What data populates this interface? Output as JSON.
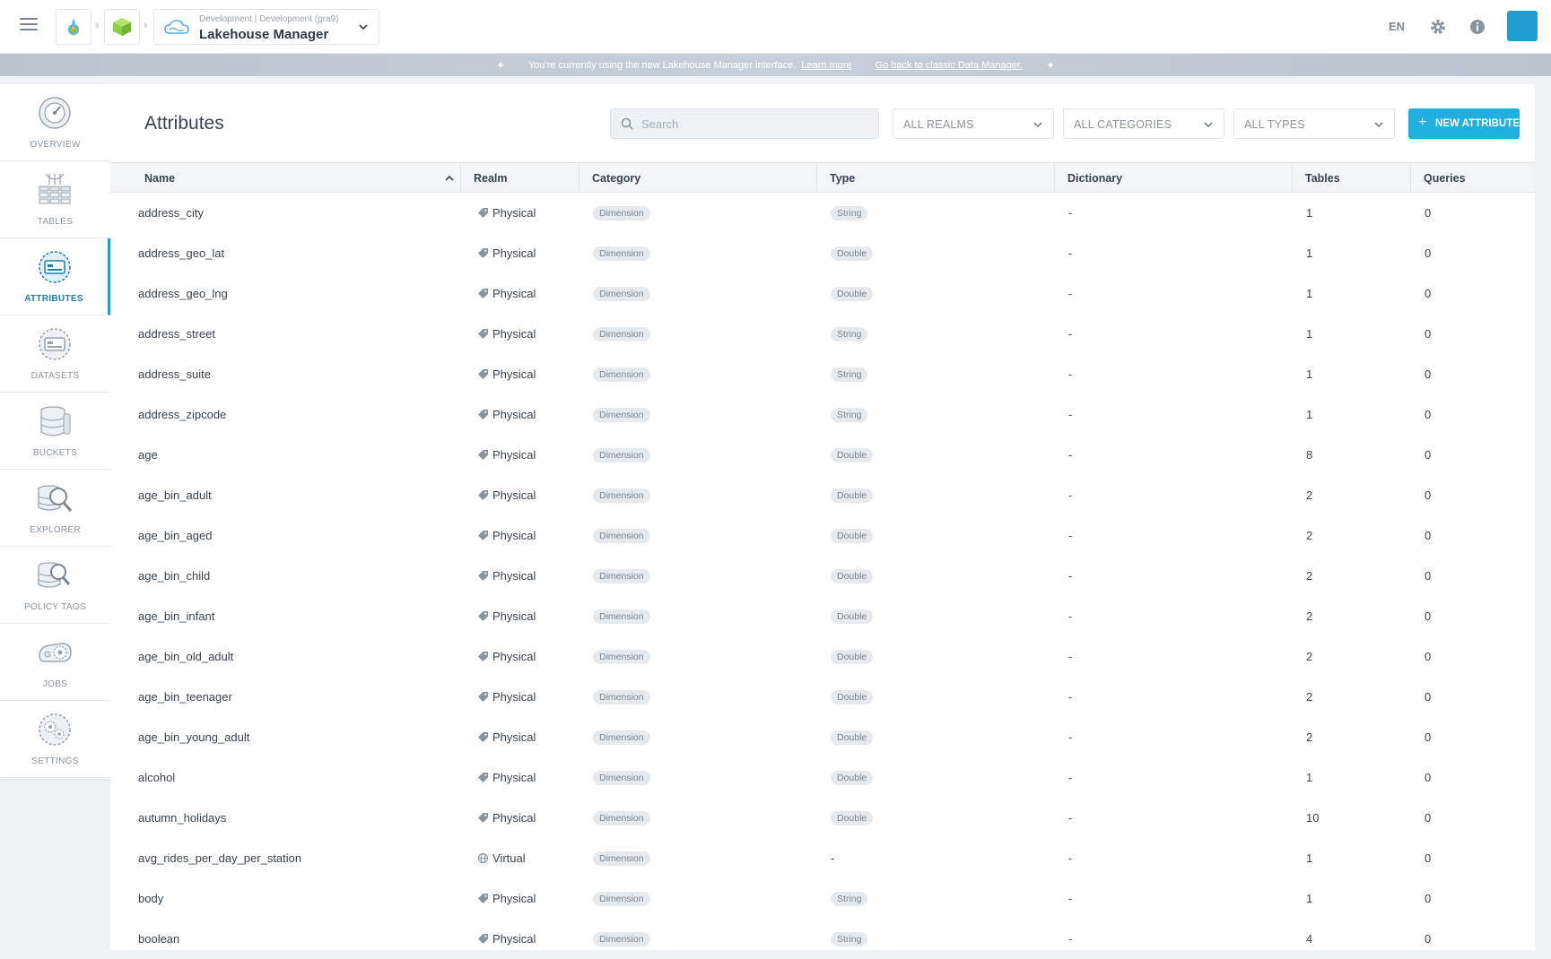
{
  "header": {
    "project_env": "Development",
    "project_sub": "Development (gra9)",
    "project_title": "Lakehouse Manager",
    "lang": "EN"
  },
  "banner": {
    "text": "You're currently using the new Lakehouse Manager interface.",
    "learn_more": "Learn more",
    "go_back": "Go back to classic Data Manager."
  },
  "sidebar": {
    "items": [
      {
        "label": "OVERVIEW",
        "icon": "dashboard-gauge-icon",
        "active": false
      },
      {
        "label": "TABLES",
        "icon": "tables-icon",
        "active": false
      },
      {
        "label": "ATTRIBUTES",
        "icon": "attributes-icon",
        "active": true
      },
      {
        "label": "DATASETS",
        "icon": "datasets-icon",
        "active": false
      },
      {
        "label": "BUCKETS",
        "icon": "buckets-database-icon",
        "active": false
      },
      {
        "label": "EXPLORER",
        "icon": "explorer-search-icon",
        "active": false
      },
      {
        "label": "POLICY TAGS",
        "icon": "policy-tags-icon",
        "active": false
      },
      {
        "label": "JOBS",
        "icon": "jobs-icon",
        "active": false
      },
      {
        "label": "SETTINGS",
        "icon": "settings-icon",
        "active": false
      }
    ]
  },
  "main": {
    "title": "Attributes",
    "search_placeholder": "Search",
    "filters": {
      "realms": "ALL REALMS",
      "categories": "ALL CATEGORIES",
      "types": "ALL TYPES"
    },
    "new_button": "NEW ATTRIBUTE"
  },
  "table": {
    "columns": [
      "Name",
      "Realm",
      "Category",
      "Type",
      "Dictionary",
      "Tables",
      "Queries"
    ],
    "rows": [
      {
        "name": "address_city",
        "realm": "Physical",
        "category": "Dimension",
        "type": "String",
        "dictionary": "-",
        "tables": "1",
        "queries": "0"
      },
      {
        "name": "address_geo_lat",
        "realm": "Physical",
        "category": "Dimension",
        "type": "Double",
        "dictionary": "-",
        "tables": "1",
        "queries": "0"
      },
      {
        "name": "address_geo_lng",
        "realm": "Physical",
        "category": "Dimension",
        "type": "Double",
        "dictionary": "-",
        "tables": "1",
        "queries": "0"
      },
      {
        "name": "address_street",
        "realm": "Physical",
        "category": "Dimension",
        "type": "String",
        "dictionary": "-",
        "tables": "1",
        "queries": "0"
      },
      {
        "name": "address_suite",
        "realm": "Physical",
        "category": "Dimension",
        "type": "String",
        "dictionary": "-",
        "tables": "1",
        "queries": "0"
      },
      {
        "name": "address_zipcode",
        "realm": "Physical",
        "category": "Dimension",
        "type": "String",
        "dictionary": "-",
        "tables": "1",
        "queries": "0"
      },
      {
        "name": "age",
        "realm": "Physical",
        "category": "Dimension",
        "type": "Double",
        "dictionary": "-",
        "tables": "8",
        "queries": "0"
      },
      {
        "name": "age_bin_adult",
        "realm": "Physical",
        "category": "Dimension",
        "type": "Double",
        "dictionary": "-",
        "tables": "2",
        "queries": "0"
      },
      {
        "name": "age_bin_aged",
        "realm": "Physical",
        "category": "Dimension",
        "type": "Double",
        "dictionary": "-",
        "tables": "2",
        "queries": "0"
      },
      {
        "name": "age_bin_child",
        "realm": "Physical",
        "category": "Dimension",
        "type": "Double",
        "dictionary": "-",
        "tables": "2",
        "queries": "0"
      },
      {
        "name": "age_bin_infant",
        "realm": "Physical",
        "category": "Dimension",
        "type": "Double",
        "dictionary": "-",
        "tables": "2",
        "queries": "0"
      },
      {
        "name": "age_bin_old_adult",
        "realm": "Physical",
        "category": "Dimension",
        "type": "Double",
        "dictionary": "-",
        "tables": "2",
        "queries": "0"
      },
      {
        "name": "age_bin_teenager",
        "realm": "Physical",
        "category": "Dimension",
        "type": "Double",
        "dictionary": "-",
        "tables": "2",
        "queries": "0"
      },
      {
        "name": "age_bin_young_adult",
        "realm": "Physical",
        "category": "Dimension",
        "type": "Double",
        "dictionary": "-",
        "tables": "2",
        "queries": "0"
      },
      {
        "name": "alcohol",
        "realm": "Physical",
        "category": "Dimension",
        "type": "Double",
        "dictionary": "-",
        "tables": "1",
        "queries": "0"
      },
      {
        "name": "autumn_holidays",
        "realm": "Physical",
        "category": "Dimension",
        "type": "Double",
        "dictionary": "-",
        "tables": "10",
        "queries": "0"
      },
      {
        "name": "avg_rides_per_day_per_station",
        "realm": "Virtual",
        "category": "Dimension",
        "type": "-",
        "dictionary": "-",
        "tables": "1",
        "queries": "0"
      },
      {
        "name": "body",
        "realm": "Physical",
        "category": "Dimension",
        "type": "String",
        "dictionary": "-",
        "tables": "1",
        "queries": "0"
      },
      {
        "name": "boolean",
        "realm": "Physical",
        "category": "Dimension",
        "type": "String",
        "dictionary": "-",
        "tables": "4",
        "queries": "0"
      }
    ]
  },
  "colors": {
    "accent": "#1fb0de",
    "active_nav": "#1f9fd1"
  }
}
